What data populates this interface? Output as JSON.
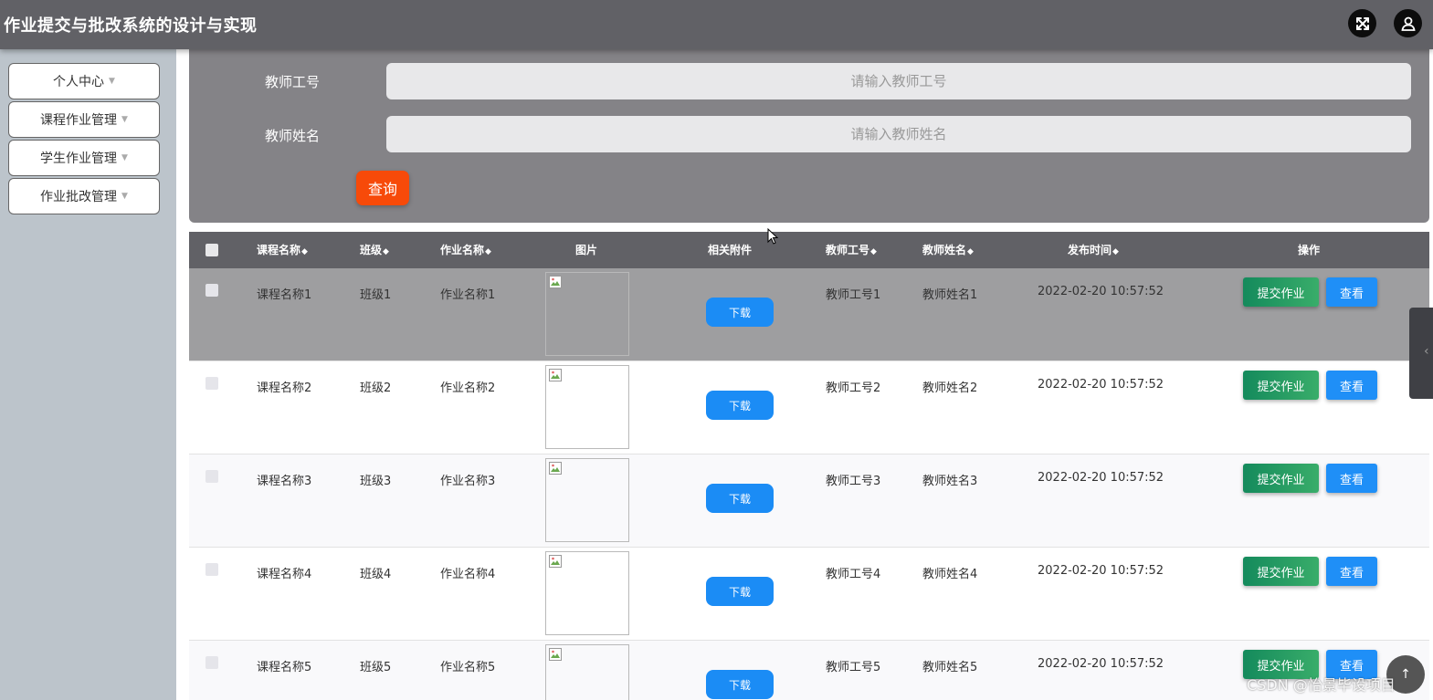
{
  "app": {
    "title": "作业提交与批改系统的设计与实现"
  },
  "sidebar": {
    "items": [
      {
        "label": "个人中心"
      },
      {
        "label": "课程作业管理"
      },
      {
        "label": "学生作业管理"
      },
      {
        "label": "作业批改管理"
      }
    ]
  },
  "search": {
    "teacher_id_label": "教师工号",
    "teacher_id_placeholder": "请输入教师工号",
    "teacher_name_label": "教师姓名",
    "teacher_name_placeholder": "请输入教师姓名",
    "query_label": "查询"
  },
  "table": {
    "columns": {
      "course": "课程名称",
      "class": "班级",
      "homework": "作业名称",
      "image": "图片",
      "attachment": "相关附件",
      "teacher_id": "教师工号",
      "teacher_name": "教师姓名",
      "publish_time": "发布时间",
      "actions": "操作"
    },
    "sort_icon": "◆",
    "rows": [
      {
        "course": "课程名称1",
        "class": "班级1",
        "homework": "作业名称1",
        "teacher_id": "教师工号1",
        "teacher_name": "教师姓名1",
        "publish_time": "2022-02-20 10:57:52",
        "download": "下载",
        "submit": "提交作业",
        "view": "查看"
      },
      {
        "course": "课程名称2",
        "class": "班级2",
        "homework": "作业名称2",
        "teacher_id": "教师工号2",
        "teacher_name": "教师姓名2",
        "publish_time": "2022-02-20 10:57:52",
        "download": "下载",
        "submit": "提交作业",
        "view": "查看"
      },
      {
        "course": "课程名称3",
        "class": "班级3",
        "homework": "作业名称3",
        "teacher_id": "教师工号3",
        "teacher_name": "教师姓名3",
        "publish_time": "2022-02-20 10:57:52",
        "download": "下载",
        "submit": "提交作业",
        "view": "查看"
      },
      {
        "course": "课程名称4",
        "class": "班级4",
        "homework": "作业名称4",
        "teacher_id": "教师工号4",
        "teacher_name": "教师姓名4",
        "publish_time": "2022-02-20 10:57:52",
        "download": "下载",
        "submit": "提交作业",
        "view": "查看"
      },
      {
        "course": "课程名称5",
        "class": "班级5",
        "homework": "作业名称5",
        "teacher_id": "教师工号5",
        "teacher_name": "教师姓名5",
        "publish_time": "2022-02-20 10:57:52",
        "download": "下载",
        "submit": "提交作业",
        "view": "查看"
      }
    ]
  },
  "watermark": "CSDN @怡景毕设项目",
  "icons": {
    "fullscreen": "fullscreen-icon",
    "user": "user-icon",
    "caret": "caret-down-icon",
    "broken_image": "broken-image-icon"
  },
  "colors": {
    "topbar": "#616166",
    "search_panel": "#848387",
    "query_button": "#f74a09",
    "primary_button": "#1b8cf5",
    "submit_button": "#148a5c",
    "highlight_row": "#9e9ea0",
    "alt_row": "#f9f9fb"
  }
}
